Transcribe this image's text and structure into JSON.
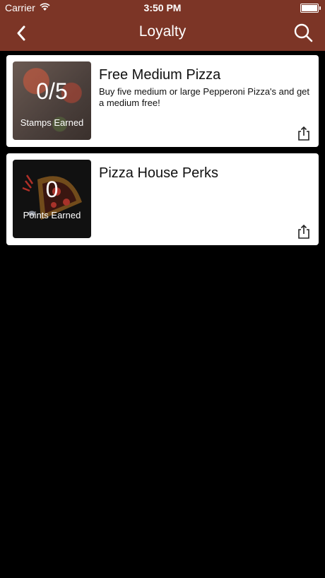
{
  "status_bar": {
    "carrier": "Carrier",
    "time": "3:50 PM"
  },
  "nav": {
    "title": "Loyalty",
    "back_icon": "chevron-left-icon",
    "search_icon": "search-icon"
  },
  "cards": [
    {
      "title": "Free Medium Pizza",
      "description": "Buy five medium or large Pepperoni Pizza's and get a medium free!",
      "count": "0/5",
      "count_label": "Stamps Earned"
    },
    {
      "title": "Pizza House Perks",
      "description": "",
      "count": "0",
      "count_label": "Points Earned"
    }
  ],
  "colors": {
    "nav_background": "#7c3526",
    "page_background": "#000000",
    "card_background": "#ffffff"
  }
}
